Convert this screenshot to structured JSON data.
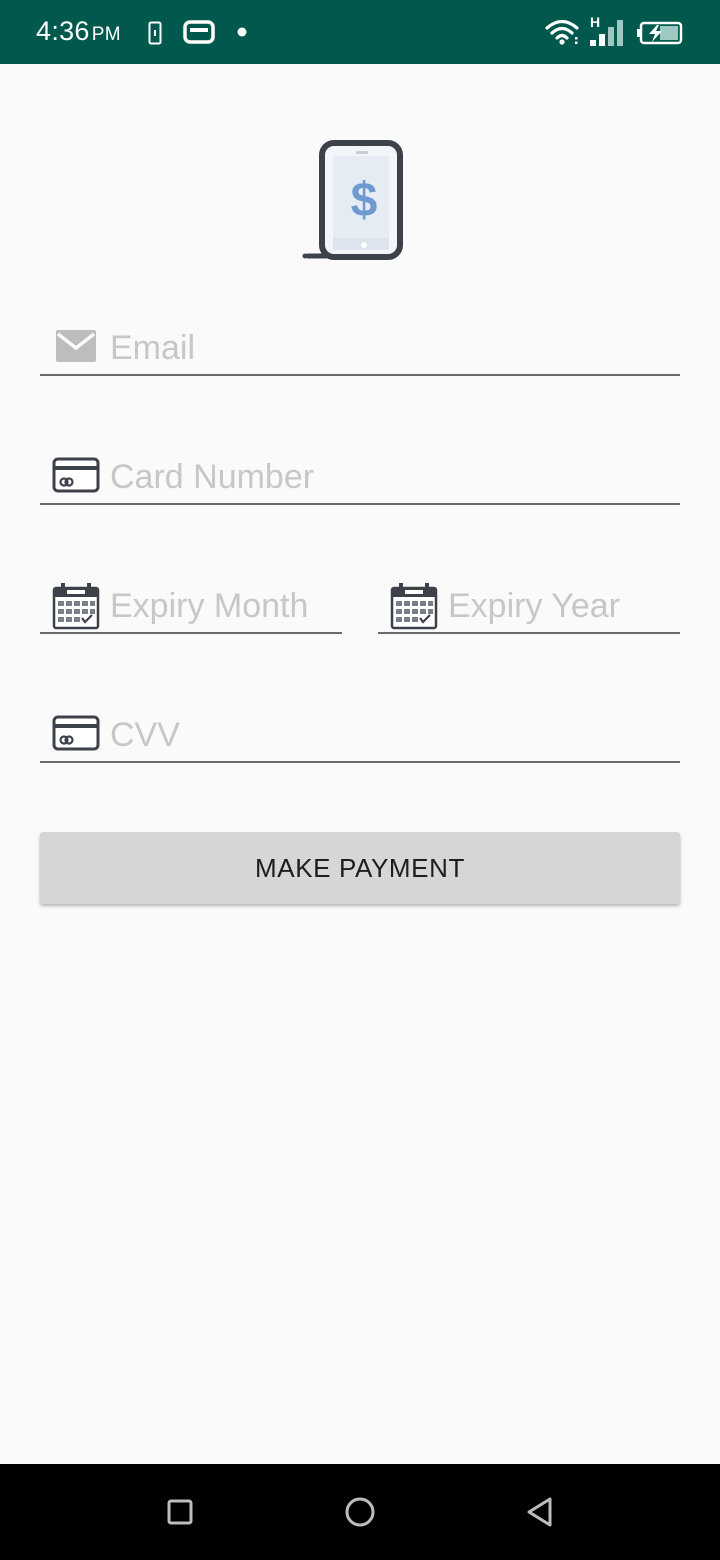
{
  "status_bar": {
    "time": "4:36",
    "ampm": "PM",
    "network_label": "H",
    "icons": [
      "sim-card-icon",
      "cast-icon",
      "notification-dot-icon",
      "wifi-icon",
      "signal-icon",
      "battery-charging-icon"
    ],
    "background_color": "#00594c"
  },
  "logo": {
    "icon": "mobile-payment-dollar-icon"
  },
  "form": {
    "email": {
      "placeholder": "Email",
      "value": "",
      "icon": "email-icon"
    },
    "card_number": {
      "placeholder": "Card Number",
      "value": "",
      "icon": "credit-card-icon"
    },
    "expiry_month": {
      "placeholder": "Expiry Month",
      "value": "",
      "icon": "calendar-icon"
    },
    "expiry_year": {
      "placeholder": "Expiry Year",
      "value": "",
      "icon": "calendar-icon"
    },
    "cvv": {
      "placeholder": "CVV",
      "value": "",
      "icon": "credit-card-icon"
    }
  },
  "pay_button": {
    "label": "MAKE PAYMENT",
    "background_color": "#d6d6d6"
  },
  "nav_bar": {
    "icons": [
      "recents-square-icon",
      "home-circle-icon",
      "back-triangle-icon"
    ]
  }
}
